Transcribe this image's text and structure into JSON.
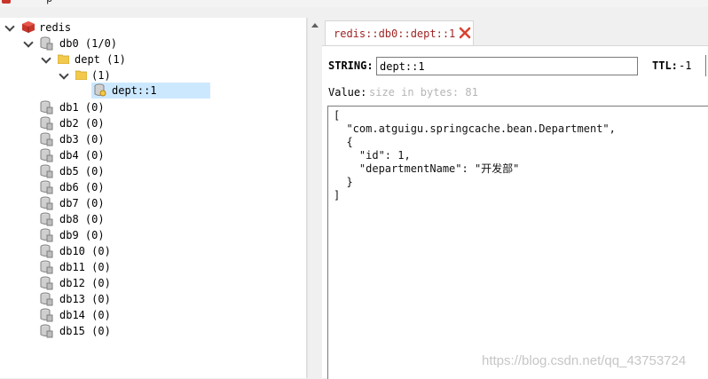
{
  "window": {
    "partial_title": "p"
  },
  "tree": {
    "root": {
      "label": "redis"
    },
    "db0": {
      "label": "db0  (1/0)"
    },
    "dept_folder": {
      "label": "dept (1)"
    },
    "blank_folder": {
      "label": " (1)"
    },
    "selected_key": {
      "label": "dept::1"
    },
    "databases": [
      {
        "label": "db1  (0)"
      },
      {
        "label": "db2  (0)"
      },
      {
        "label": "db3  (0)"
      },
      {
        "label": "db4  (0)"
      },
      {
        "label": "db5  (0)"
      },
      {
        "label": "db6  (0)"
      },
      {
        "label": "db7  (0)"
      },
      {
        "label": "db8  (0)"
      },
      {
        "label": "db9  (0)"
      },
      {
        "label": "db10  (0)"
      },
      {
        "label": "db11  (0)"
      },
      {
        "label": "db12  (0)"
      },
      {
        "label": "db13  (0)"
      },
      {
        "label": "db14  (0)"
      },
      {
        "label": "db15  (0)"
      }
    ]
  },
  "editor_tab": {
    "label": "redis::db0::dept::1"
  },
  "key_info": {
    "type_label": "STRING:",
    "key_value": "dept::1",
    "ttl_label": "TTL:",
    "ttl_value": "-1",
    "value_label": "Value:",
    "size_text": "size in bytes: 81"
  },
  "value_text": "[\n  \"com.atguigu.springcache.bean.Department\",\n  {\n    \"id\": 1,\n    \"departmentName\": \"开发部\"\n  }\n]",
  "watermark": "https://blog.csdn.net/qq_43753724",
  "colors": {
    "selection": "#cce8ff",
    "tab_text": "#a02525",
    "redis_red": "#c8352b",
    "folder_yellow": "#f2c94c"
  }
}
